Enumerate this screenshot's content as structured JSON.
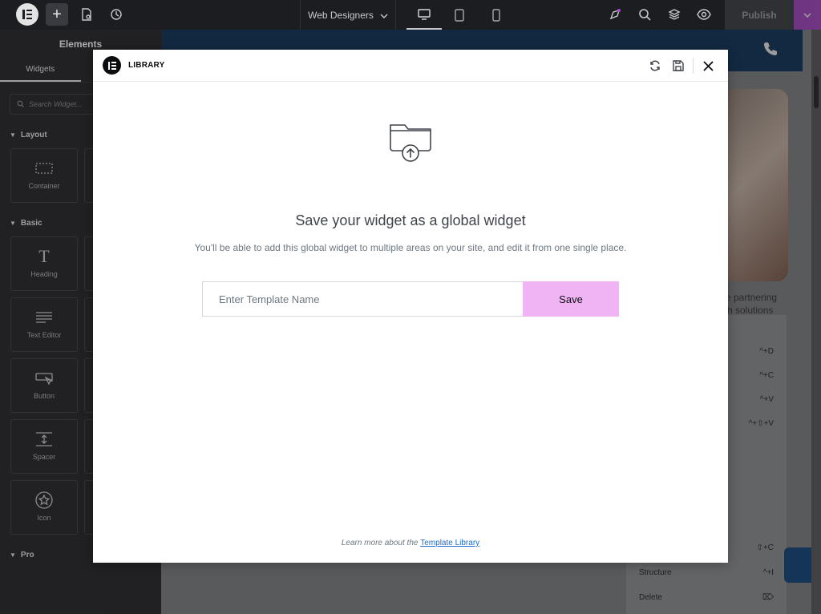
{
  "topbar": {
    "site_name": "Web Designers",
    "publish_label": "Publish"
  },
  "sidebar": {
    "title": "Elements",
    "tabs": [
      "Widgets",
      ""
    ],
    "search_placeholder": "Search Widget...",
    "sections": [
      {
        "label": "Layout",
        "items": [
          "Container",
          ""
        ]
      },
      {
        "label": "Basic",
        "items": [
          "Heading",
          "",
          "Text Editor",
          "",
          "Button",
          "",
          "Spacer",
          "",
          "Icon",
          ""
        ]
      },
      {
        "label": "Pro",
        "items": []
      }
    ]
  },
  "canvas": {
    "text_line1": "re partnering",
    "text_line2": "ch solutions",
    "context_menu": [
      {
        "label": "",
        "shortcut": "^+D"
      },
      {
        "label": "",
        "shortcut": "^+C"
      },
      {
        "label": "",
        "shortcut": "^+V"
      },
      {
        "label": "",
        "shortcut": "^+⇧+V"
      },
      {
        "label": "",
        "shortcut": "⇧+C"
      },
      {
        "label": "Structure",
        "shortcut": "^+I"
      },
      {
        "label": "Delete",
        "shortcut": "⌦"
      }
    ]
  },
  "modal": {
    "title": "LIBRARY",
    "heading": "Save your widget as a global widget",
    "subtext": "You'll be able to add this global widget to multiple areas on your site, and edit it from one single place.",
    "input_placeholder": "Enter Template Name",
    "input_value": "",
    "save_label": "Save",
    "footer_text": "Learn more about the ",
    "footer_link": "Template Library"
  },
  "colors": {
    "accent": "#f0b4f4",
    "link": "#1f6cc7",
    "text": "#3f444b"
  },
  "icons": [
    "elementor-logo-icon",
    "plus-icon",
    "page-settings-icon",
    "history-icon",
    "chevron-down-icon",
    "desktop-icon",
    "tablet-icon",
    "mobile-icon",
    "notifications-icon",
    "search-icon",
    "layers-icon",
    "eye-icon",
    "sync-icon",
    "save-icon",
    "close-icon",
    "folder-upload-icon"
  ]
}
